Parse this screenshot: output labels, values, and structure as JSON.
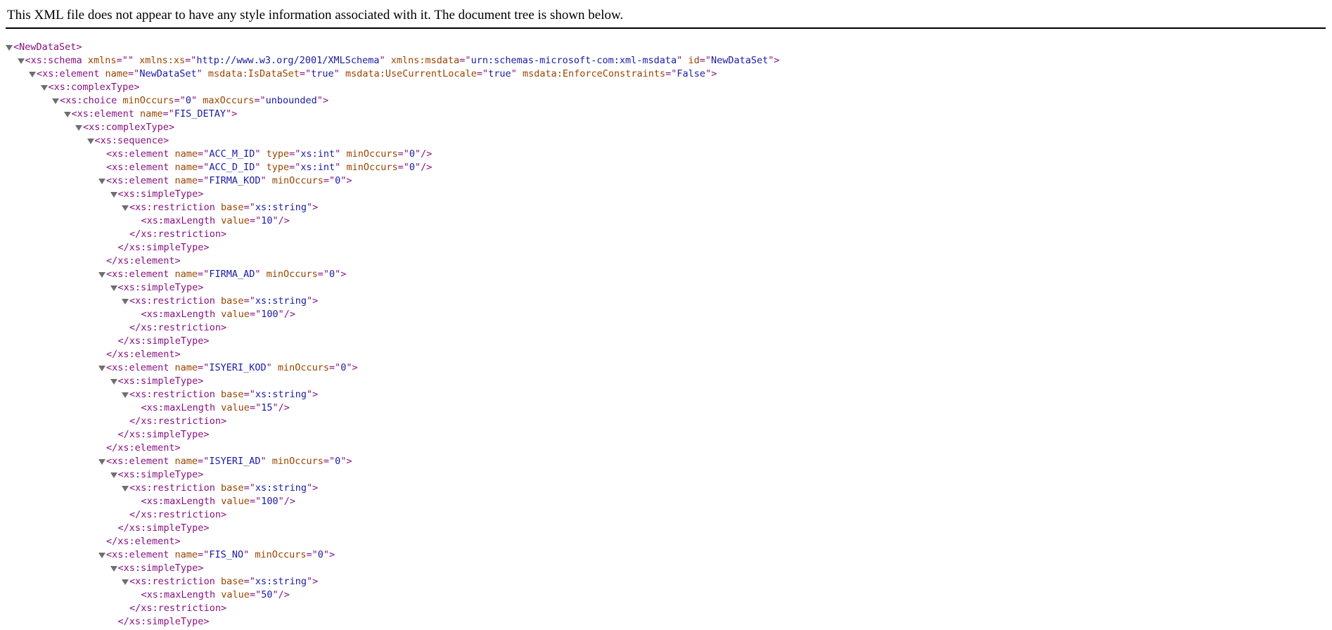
{
  "header": {
    "message": "This XML file does not appear to have any style information associated with it. The document tree is shown below."
  },
  "colors": {
    "tag": "#881280",
    "attr_name": "#994500",
    "attr_value": "#1a1aa6",
    "toggle": "#6e6e6e"
  },
  "tree": [
    {
      "indent": 0,
      "toggle": true,
      "parts": [
        [
          "t",
          "<NewDataSet>"
        ]
      ]
    },
    {
      "indent": 1,
      "toggle": true,
      "parts": [
        [
          "t",
          "<xs:schema"
        ],
        [
          "n",
          " xmlns"
        ],
        [
          "t",
          "=\""
        ],
        [
          "v",
          ""
        ],
        [
          "t",
          "\""
        ],
        [
          "n",
          " xmlns:xs"
        ],
        [
          "t",
          "=\""
        ],
        [
          "v",
          "http://www.w3.org/2001/XMLSchema"
        ],
        [
          "t",
          "\""
        ],
        [
          "n",
          " xmlns:msdata"
        ],
        [
          "t",
          "=\""
        ],
        [
          "v",
          "urn:schemas-microsoft-com:xml-msdata"
        ],
        [
          "t",
          "\""
        ],
        [
          "n",
          " id"
        ],
        [
          "t",
          "=\""
        ],
        [
          "v",
          "NewDataSet"
        ],
        [
          "t",
          "\">"
        ]
      ]
    },
    {
      "indent": 2,
      "toggle": true,
      "parts": [
        [
          "t",
          "<xs:element"
        ],
        [
          "n",
          " name"
        ],
        [
          "t",
          "=\""
        ],
        [
          "v",
          "NewDataSet"
        ],
        [
          "t",
          "\""
        ],
        [
          "n",
          " msdata:IsDataSet"
        ],
        [
          "t",
          "=\""
        ],
        [
          "v",
          "true"
        ],
        [
          "t",
          "\""
        ],
        [
          "n",
          " msdata:UseCurrentLocale"
        ],
        [
          "t",
          "=\""
        ],
        [
          "v",
          "true"
        ],
        [
          "t",
          "\""
        ],
        [
          "n",
          " msdata:EnforceConstraints"
        ],
        [
          "t",
          "=\""
        ],
        [
          "v",
          "False"
        ],
        [
          "t",
          "\">"
        ]
      ]
    },
    {
      "indent": 3,
      "toggle": true,
      "parts": [
        [
          "t",
          "<xs:complexType>"
        ]
      ]
    },
    {
      "indent": 4,
      "toggle": true,
      "parts": [
        [
          "t",
          "<xs:choice"
        ],
        [
          "n",
          " minOccurs"
        ],
        [
          "t",
          "=\""
        ],
        [
          "v",
          "0"
        ],
        [
          "t",
          "\""
        ],
        [
          "n",
          " maxOccurs"
        ],
        [
          "t",
          "=\""
        ],
        [
          "v",
          "unbounded"
        ],
        [
          "t",
          "\">"
        ]
      ]
    },
    {
      "indent": 5,
      "toggle": true,
      "parts": [
        [
          "t",
          "<xs:element"
        ],
        [
          "n",
          " name"
        ],
        [
          "t",
          "=\""
        ],
        [
          "v",
          "FIS_DETAY"
        ],
        [
          "t",
          "\">"
        ]
      ]
    },
    {
      "indent": 6,
      "toggle": true,
      "parts": [
        [
          "t",
          "<xs:complexType>"
        ]
      ]
    },
    {
      "indent": 7,
      "toggle": true,
      "parts": [
        [
          "t",
          "<xs:sequence>"
        ]
      ]
    },
    {
      "indent": 8,
      "toggle": false,
      "parts": [
        [
          "t",
          "<xs:element"
        ],
        [
          "n",
          " name"
        ],
        [
          "t",
          "=\""
        ],
        [
          "v",
          "ACC_M_ID"
        ],
        [
          "t",
          "\""
        ],
        [
          "n",
          " type"
        ],
        [
          "t",
          "=\""
        ],
        [
          "v",
          "xs:int"
        ],
        [
          "t",
          "\""
        ],
        [
          "n",
          " minOccurs"
        ],
        [
          "t",
          "=\""
        ],
        [
          "v",
          "0"
        ],
        [
          "t",
          "\"/>"
        ]
      ]
    },
    {
      "indent": 8,
      "toggle": false,
      "parts": [
        [
          "t",
          "<xs:element"
        ],
        [
          "n",
          " name"
        ],
        [
          "t",
          "=\""
        ],
        [
          "v",
          "ACC_D_ID"
        ],
        [
          "t",
          "\""
        ],
        [
          "n",
          " type"
        ],
        [
          "t",
          "=\""
        ],
        [
          "v",
          "xs:int"
        ],
        [
          "t",
          "\""
        ],
        [
          "n",
          " minOccurs"
        ],
        [
          "t",
          "=\""
        ],
        [
          "v",
          "0"
        ],
        [
          "t",
          "\"/>"
        ]
      ]
    },
    {
      "indent": 8,
      "toggle": true,
      "parts": [
        [
          "t",
          "<xs:element"
        ],
        [
          "n",
          " name"
        ],
        [
          "t",
          "=\""
        ],
        [
          "v",
          "FIRMA_KOD"
        ],
        [
          "t",
          "\""
        ],
        [
          "n",
          " minOccurs"
        ],
        [
          "t",
          "=\""
        ],
        [
          "v",
          "0"
        ],
        [
          "t",
          "\">"
        ]
      ]
    },
    {
      "indent": 9,
      "toggle": true,
      "parts": [
        [
          "t",
          "<xs:simpleType>"
        ]
      ]
    },
    {
      "indent": 10,
      "toggle": true,
      "parts": [
        [
          "t",
          "<xs:restriction"
        ],
        [
          "n",
          " base"
        ],
        [
          "t",
          "=\""
        ],
        [
          "v",
          "xs:string"
        ],
        [
          "t",
          "\">"
        ]
      ]
    },
    {
      "indent": 11,
      "toggle": false,
      "parts": [
        [
          "t",
          "<xs:maxLength"
        ],
        [
          "n",
          " value"
        ],
        [
          "t",
          "=\""
        ],
        [
          "v",
          "10"
        ],
        [
          "t",
          "\"/>"
        ]
      ]
    },
    {
      "indent": 10,
      "toggle": false,
      "parts": [
        [
          "t",
          "</xs:restriction>"
        ]
      ]
    },
    {
      "indent": 9,
      "toggle": false,
      "parts": [
        [
          "t",
          "</xs:simpleType>"
        ]
      ]
    },
    {
      "indent": 8,
      "toggle": false,
      "parts": [
        [
          "t",
          "</xs:element>"
        ]
      ]
    },
    {
      "indent": 8,
      "toggle": true,
      "parts": [
        [
          "t",
          "<xs:element"
        ],
        [
          "n",
          " name"
        ],
        [
          "t",
          "=\""
        ],
        [
          "v",
          "FIRMA_AD"
        ],
        [
          "t",
          "\""
        ],
        [
          "n",
          " minOccurs"
        ],
        [
          "t",
          "=\""
        ],
        [
          "v",
          "0"
        ],
        [
          "t",
          "\">"
        ]
      ]
    },
    {
      "indent": 9,
      "toggle": true,
      "parts": [
        [
          "t",
          "<xs:simpleType>"
        ]
      ]
    },
    {
      "indent": 10,
      "toggle": true,
      "parts": [
        [
          "t",
          "<xs:restriction"
        ],
        [
          "n",
          " base"
        ],
        [
          "t",
          "=\""
        ],
        [
          "v",
          "xs:string"
        ],
        [
          "t",
          "\">"
        ]
      ]
    },
    {
      "indent": 11,
      "toggle": false,
      "parts": [
        [
          "t",
          "<xs:maxLength"
        ],
        [
          "n",
          " value"
        ],
        [
          "t",
          "=\""
        ],
        [
          "v",
          "100"
        ],
        [
          "t",
          "\"/>"
        ]
      ]
    },
    {
      "indent": 10,
      "toggle": false,
      "parts": [
        [
          "t",
          "</xs:restriction>"
        ]
      ]
    },
    {
      "indent": 9,
      "toggle": false,
      "parts": [
        [
          "t",
          "</xs:simpleType>"
        ]
      ]
    },
    {
      "indent": 8,
      "toggle": false,
      "parts": [
        [
          "t",
          "</xs:element>"
        ]
      ]
    },
    {
      "indent": 8,
      "toggle": true,
      "parts": [
        [
          "t",
          "<xs:element"
        ],
        [
          "n",
          " name"
        ],
        [
          "t",
          "=\""
        ],
        [
          "v",
          "ISYERI_KOD"
        ],
        [
          "t",
          "\""
        ],
        [
          "n",
          " minOccurs"
        ],
        [
          "t",
          "=\""
        ],
        [
          "v",
          "0"
        ],
        [
          "t",
          "\">"
        ]
      ]
    },
    {
      "indent": 9,
      "toggle": true,
      "parts": [
        [
          "t",
          "<xs:simpleType>"
        ]
      ]
    },
    {
      "indent": 10,
      "toggle": true,
      "parts": [
        [
          "t",
          "<xs:restriction"
        ],
        [
          "n",
          " base"
        ],
        [
          "t",
          "=\""
        ],
        [
          "v",
          "xs:string"
        ],
        [
          "t",
          "\">"
        ]
      ]
    },
    {
      "indent": 11,
      "toggle": false,
      "parts": [
        [
          "t",
          "<xs:maxLength"
        ],
        [
          "n",
          " value"
        ],
        [
          "t",
          "=\""
        ],
        [
          "v",
          "15"
        ],
        [
          "t",
          "\"/>"
        ]
      ]
    },
    {
      "indent": 10,
      "toggle": false,
      "parts": [
        [
          "t",
          "</xs:restriction>"
        ]
      ]
    },
    {
      "indent": 9,
      "toggle": false,
      "parts": [
        [
          "t",
          "</xs:simpleType>"
        ]
      ]
    },
    {
      "indent": 8,
      "toggle": false,
      "parts": [
        [
          "t",
          "</xs:element>"
        ]
      ]
    },
    {
      "indent": 8,
      "toggle": true,
      "parts": [
        [
          "t",
          "<xs:element"
        ],
        [
          "n",
          " name"
        ],
        [
          "t",
          "=\""
        ],
        [
          "v",
          "ISYERI_AD"
        ],
        [
          "t",
          "\""
        ],
        [
          "n",
          " minOccurs"
        ],
        [
          "t",
          "=\""
        ],
        [
          "v",
          "0"
        ],
        [
          "t",
          "\">"
        ]
      ]
    },
    {
      "indent": 9,
      "toggle": true,
      "parts": [
        [
          "t",
          "<xs:simpleType>"
        ]
      ]
    },
    {
      "indent": 10,
      "toggle": true,
      "parts": [
        [
          "t",
          "<xs:restriction"
        ],
        [
          "n",
          " base"
        ],
        [
          "t",
          "=\""
        ],
        [
          "v",
          "xs:string"
        ],
        [
          "t",
          "\">"
        ]
      ]
    },
    {
      "indent": 11,
      "toggle": false,
      "parts": [
        [
          "t",
          "<xs:maxLength"
        ],
        [
          "n",
          " value"
        ],
        [
          "t",
          "=\""
        ],
        [
          "v",
          "100"
        ],
        [
          "t",
          "\"/>"
        ]
      ]
    },
    {
      "indent": 10,
      "toggle": false,
      "parts": [
        [
          "t",
          "</xs:restriction>"
        ]
      ]
    },
    {
      "indent": 9,
      "toggle": false,
      "parts": [
        [
          "t",
          "</xs:simpleType>"
        ]
      ]
    },
    {
      "indent": 8,
      "toggle": false,
      "parts": [
        [
          "t",
          "</xs:element>"
        ]
      ]
    },
    {
      "indent": 8,
      "toggle": true,
      "parts": [
        [
          "t",
          "<xs:element"
        ],
        [
          "n",
          " name"
        ],
        [
          "t",
          "=\""
        ],
        [
          "v",
          "FIS_NO"
        ],
        [
          "t",
          "\""
        ],
        [
          "n",
          " minOccurs"
        ],
        [
          "t",
          "=\""
        ],
        [
          "v",
          "0"
        ],
        [
          "t",
          "\">"
        ]
      ]
    },
    {
      "indent": 9,
      "toggle": true,
      "parts": [
        [
          "t",
          "<xs:simpleType>"
        ]
      ]
    },
    {
      "indent": 10,
      "toggle": true,
      "parts": [
        [
          "t",
          "<xs:restriction"
        ],
        [
          "n",
          " base"
        ],
        [
          "t",
          "=\""
        ],
        [
          "v",
          "xs:string"
        ],
        [
          "t",
          "\">"
        ]
      ]
    },
    {
      "indent": 11,
      "toggle": false,
      "parts": [
        [
          "t",
          "<xs:maxLength"
        ],
        [
          "n",
          " value"
        ],
        [
          "t",
          "=\""
        ],
        [
          "v",
          "50"
        ],
        [
          "t",
          "\"/>"
        ]
      ]
    },
    {
      "indent": 10,
      "toggle": false,
      "parts": [
        [
          "t",
          "</xs:restriction>"
        ]
      ]
    },
    {
      "indent": 9,
      "toggle": false,
      "parts": [
        [
          "t",
          "</xs:simpleType>"
        ]
      ]
    }
  ]
}
